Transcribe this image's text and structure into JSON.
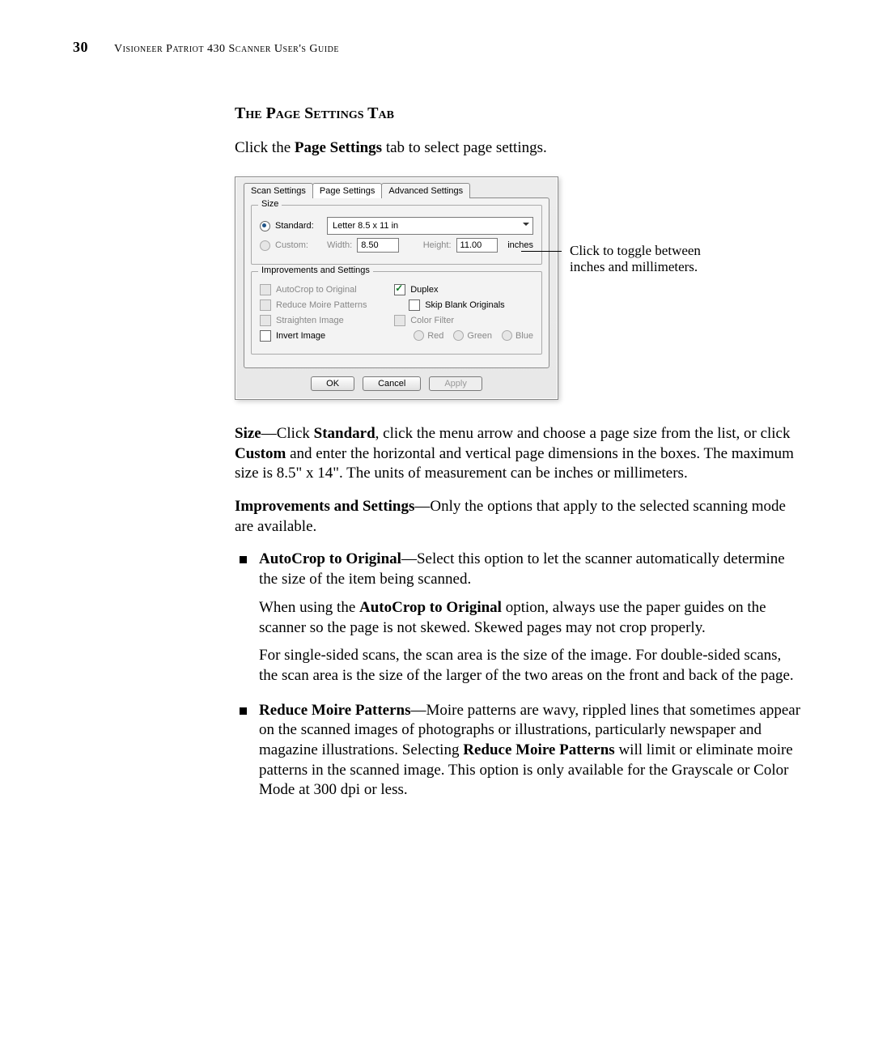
{
  "page_number": "30",
  "running_head": "Visioneer Patriot 430 Scanner User's Guide",
  "section_title": "The Page Settings Tab",
  "intro_pre": "Click the ",
  "intro_bold": "Page Settings",
  "intro_post": " tab to select page settings.",
  "dialog": {
    "tabs": {
      "scan": "Scan Settings",
      "page": "Page Settings",
      "adv": "Advanced Settings"
    },
    "size": {
      "legend": "Size",
      "standard_label": "Standard:",
      "standard_value": "Letter 8.5 x 11 in",
      "custom_label": "Custom:",
      "width_label": "Width:",
      "width_value": "8.50",
      "height_label": "Height:",
      "height_value": "11.00",
      "units": "inches"
    },
    "imp": {
      "legend": "Improvements and Settings",
      "autocrop": "AutoCrop to Original",
      "moire": "Reduce Moire Patterns",
      "straighten": "Straighten Image",
      "invert": "Invert Image",
      "duplex": "Duplex",
      "skip": "Skip Blank Originals",
      "colorfilter": "Color Filter",
      "red": "Red",
      "green": "Green",
      "blue": "Blue"
    },
    "buttons": {
      "ok": "OK",
      "cancel": "Cancel",
      "apply": "Apply"
    }
  },
  "callout": "Click to toggle between inches and millimeters.",
  "para_size": "—Click <b>Standard</b>, click the menu arrow and choose a page size from the list, or click <b>Custom</b> and enter the horizontal and vertical page dimensions in the boxes. The maximum size is 8.5\" x 14\". The units of measurement can be inches or millimeters.",
  "size_lead": "Size",
  "imp_lead": "Improvements and Settings",
  "para_imp": "—Only the options that apply to the selected scanning mode are available.",
  "bullets": {
    "autocrop_lead": "AutoCrop to Original",
    "autocrop_text": "—Select this option to let the scanner automatically determine the size of the item being scanned.",
    "autocrop_p2_pre": "When using the ",
    "autocrop_p2_bold": "AutoCrop to Original",
    "autocrop_p2_post": " option, always use the paper guides on the scanner so the page is not skewed. Skewed pages may not crop properly.",
    "autocrop_p3": "For single-sided scans, the scan area is the size of the image. For double-sided scans, the scan area is the size of the larger of the two areas on the front and back of the page.",
    "moire_lead": "Reduce Moire Patterns",
    "moire_text": "—Moire patterns are wavy, rippled lines that sometimes appear on the scanned images of photographs or illustrations, particularly newspaper and magazine illustrations. Selecting <b>Reduce Moire Patterns</b> will limit or eliminate moire patterns in the scanned image. This option is only available for the Grayscale or Color Mode at 300 dpi or less."
  }
}
